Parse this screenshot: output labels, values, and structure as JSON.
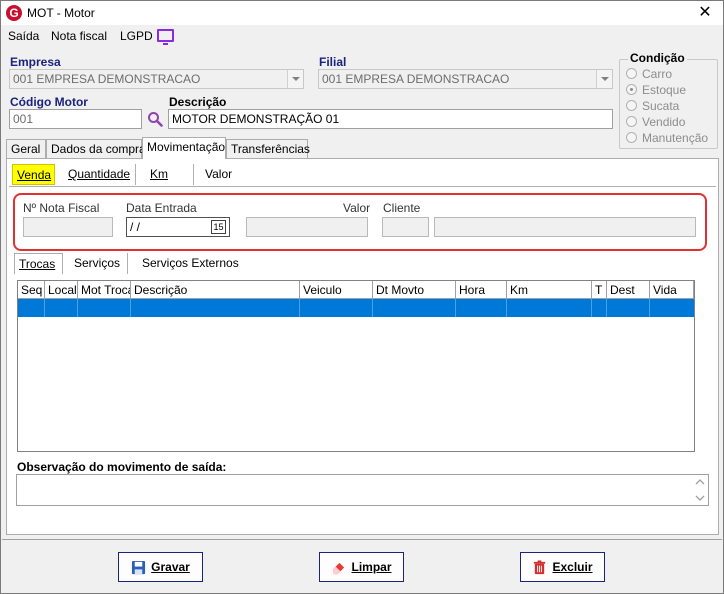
{
  "window": {
    "title": "MOT - Motor",
    "app_icon": "G",
    "close_glyph": "✕"
  },
  "menu": {
    "items": [
      "Saída",
      "Nota fiscal",
      "LGPD"
    ]
  },
  "empresa": {
    "label": "Empresa",
    "value": "001 EMPRESA DEMONSTRACAO"
  },
  "filial": {
    "label": "Filial",
    "value": "001 EMPRESA DEMONSTRACAO"
  },
  "codigo": {
    "label": "Código Motor",
    "value": "001"
  },
  "descricao": {
    "label": "Descrição",
    "value": "MOTOR DEMONSTRAÇÃO 01"
  },
  "condicao": {
    "title": "Condição",
    "options": [
      {
        "label": "Carro",
        "checked": false
      },
      {
        "label": "Estoque",
        "checked": true
      },
      {
        "label": "Sucata",
        "checked": false
      },
      {
        "label": "Vendido",
        "checked": false
      },
      {
        "label": "Manutenção",
        "checked": false
      }
    ]
  },
  "tabs": [
    {
      "label": "Geral"
    },
    {
      "label": "Dados da compra"
    },
    {
      "label": "Movimentação",
      "active": true
    },
    {
      "label": "Transferências"
    }
  ],
  "subtabs": [
    {
      "label": "Venda",
      "active": true
    },
    {
      "label": "Quantidade"
    },
    {
      "label": "Km"
    },
    {
      "label": "Valor"
    }
  ],
  "venda": {
    "nota_fiscal_label": "Nº Nota Fiscal",
    "data_entrada_label": "Data Entrada",
    "data_entrada_value": " /  /",
    "calendar_icon": "15",
    "valor_label": "Valor",
    "cliente_label": "Cliente"
  },
  "subtabs2": [
    {
      "label": "Trocas",
      "active": true
    },
    {
      "label": "Serviços"
    },
    {
      "label": "Serviços Externos"
    }
  ],
  "grid": {
    "columns": [
      "Seq",
      "Local",
      "Mot Troca",
      "Descrição",
      "Veiculo",
      "Dt Movto",
      "Hora",
      "Km",
      "T",
      "Dest",
      "Vida"
    ]
  },
  "observacao": {
    "label": "Observação do movimento de saída:",
    "value": ""
  },
  "buttons": {
    "gravar": "Gravar",
    "limpar": "Limpar",
    "excluir": "Excluir"
  },
  "colors": {
    "selection": "#0078d7",
    "highlight_tab": "#ffff00",
    "red_frame": "#e03030",
    "label_blue": "#1a237e"
  }
}
